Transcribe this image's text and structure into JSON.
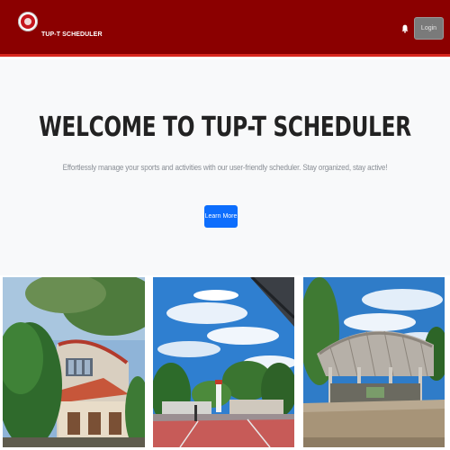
{
  "header": {
    "brand": "TUP-T SCHEDULER",
    "login_label": "Login",
    "background": "#8b0000"
  },
  "hero": {
    "title": "WELCOME TO TUP-T SCHEDULER",
    "subtitle": "Effortlessly manage your sports and activities with our user-friendly scheduler. Stay organized, stay active!",
    "cta_label": "Learn More",
    "cta_color": "#0d6efd"
  },
  "icons": {
    "logo": "university-seal-icon",
    "notification": "bell-icon"
  },
  "gallery": {
    "photos": [
      "campus-building-photo",
      "campus-court-photo",
      "covered-court-photo"
    ]
  }
}
